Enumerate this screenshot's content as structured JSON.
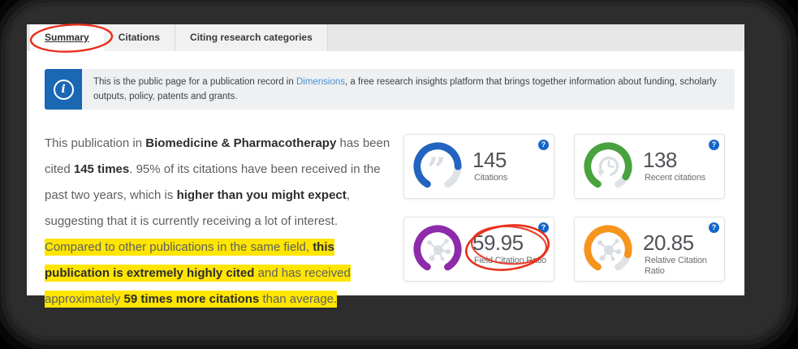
{
  "tabs": [
    {
      "label": "Summary"
    },
    {
      "label": "Citations"
    },
    {
      "label": "Citing research categories"
    }
  ],
  "banner": {
    "icon_glyph": "i",
    "text_before_link": "This is the public page for a publication record in ",
    "link_label": "Dimensions",
    "text_after_link": ", a free research insights platform that brings together information about funding, scholarly outputs, policy, patents and grants."
  },
  "summary": {
    "para1": {
      "s1": "This publication in ",
      "b1": "Biomedicine & Pharmacotherapy",
      "s2": " has been cited ",
      "b2": "145 times",
      "s3": ". 95% of its citations have been received in the past two years, which is ",
      "b3": "higher than you might expect",
      "s4": ", suggesting that it is currently receiving a lot of interest."
    },
    "para2": {
      "s1": "Compared to other publications in the same field, ",
      "b1": "this publication is extremely highly cited",
      "s2": " and has received approximately ",
      "b2": "59 times more citations",
      "s3": " than average."
    }
  },
  "cards": [
    {
      "value": "145",
      "label": "Citations",
      "icon": "quotation-marks-icon",
      "color": "#2264c0",
      "dash": "108.9 163.4"
    },
    {
      "value": "138",
      "label": "Recent citations",
      "icon": "clock-history-icon",
      "color": "#48a23e",
      "dash": "122.5 163.4"
    },
    {
      "value": "59.95",
      "label": "Field Citation Ratio",
      "icon": "citation-network-icon",
      "color": "#8d2baa",
      "dash": "136.1 163.4"
    },
    {
      "value": "20.85",
      "label": "Relative Citation Ratio",
      "icon": "citation-network-icon",
      "color": "#f7941e",
      "dash": "115.7 163.4"
    }
  ],
  "ui": {
    "help_glyph": "?",
    "help_color": "#1466c8",
    "track_dash": "136.1 163.4",
    "track_color": "#dfe3e6",
    "icon_color": "#d9dee3",
    "highlight_color": "#ffe500",
    "annotation_color": "#e8301c",
    "link_color": "#4a8fd4"
  }
}
